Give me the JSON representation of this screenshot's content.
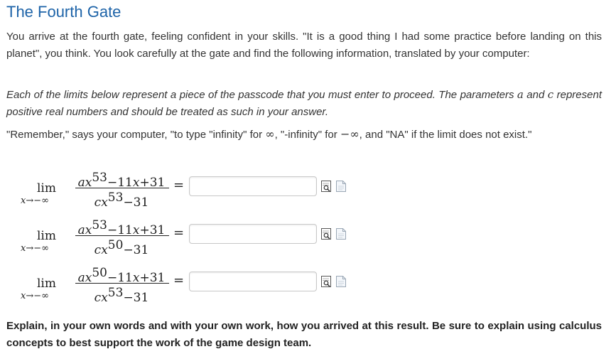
{
  "title": "The Fourth Gate",
  "intro": "You arrive at the fourth gate, feeling confident in your skills. \"It is a good thing I had some practice before landing on this planet\", you think. You look carefully at the gate and find the following information, translated by your computer:",
  "instructions": {
    "part1": "Each of the limits below represent a piece of the passcode that you must enter to proceed. The parameters ",
    "var_a": "a",
    "part2": " and ",
    "var_c": "c",
    "part3": " represent positive real numbers and should be treated as such in your answer."
  },
  "reminder": {
    "part1": "\"Remember,\" says your computer, \"to type \"infinity\" for ",
    "inf": "∞",
    "part2": ", \"-infinity\" for ",
    "neg_inf": "−∞",
    "part3": ", and \"NA\" if the limit does not exist.\""
  },
  "limits": [
    {
      "lim": "lim",
      "sub": "x→−∞",
      "num": {
        "a": "a",
        "x": "x",
        "exp": "53",
        "rest": "−11",
        "x2": "x",
        "c": "+31"
      },
      "den": {
        "c": "c",
        "x": "x",
        "exp": "53",
        "rest": "−31"
      },
      "eq": "=",
      "answer_value": ""
    },
    {
      "lim": "lim",
      "sub": "x→−∞",
      "num": {
        "a": "a",
        "x": "x",
        "exp": "53",
        "rest": "−11",
        "x2": "x",
        "c": "+31"
      },
      "den": {
        "c": "c",
        "x": "x",
        "exp": "50",
        "rest": "−31"
      },
      "eq": "=",
      "answer_value": ""
    },
    {
      "lim": "lim",
      "sub": "x→−∞",
      "num": {
        "a": "a",
        "x": "x",
        "exp": "50",
        "rest": "−11",
        "x2": "x",
        "c": "+31"
      },
      "den": {
        "c": "c",
        "x": "x",
        "exp": "53",
        "rest": "−31"
      },
      "eq": "=",
      "answer_value": ""
    }
  ],
  "explain": "Explain, in your own words and with your own work, how you arrived at this result. Be sure to explain using calculus concepts to best support the work of the game design team.",
  "icons": {
    "preview": "preview-icon",
    "help": "help-icon"
  }
}
